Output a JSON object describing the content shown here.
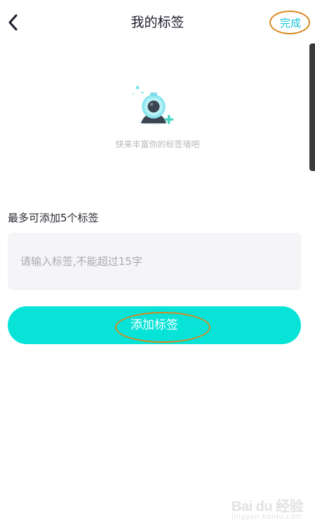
{
  "header": {
    "title": "我的标签",
    "done_label": "完成",
    "back_icon": "chevron-left-icon"
  },
  "empty_state": {
    "illustration": "camera-tag-illustration",
    "text": "快来丰富你的标签墙吧"
  },
  "form": {
    "limit_hint": "最多可添加5个标签",
    "input_placeholder": "请输入标签,不能超过15字",
    "input_value": "",
    "add_button_label": "添加标签"
  },
  "watermark": {
    "logo": "Bai du 经验",
    "sub": "jingyan.baidu.com"
  },
  "colors": {
    "accent": "#07e3d7",
    "done_text": "#17c6d6",
    "annotation": "#d6891e",
    "input_bg": "#f5f5f8"
  }
}
